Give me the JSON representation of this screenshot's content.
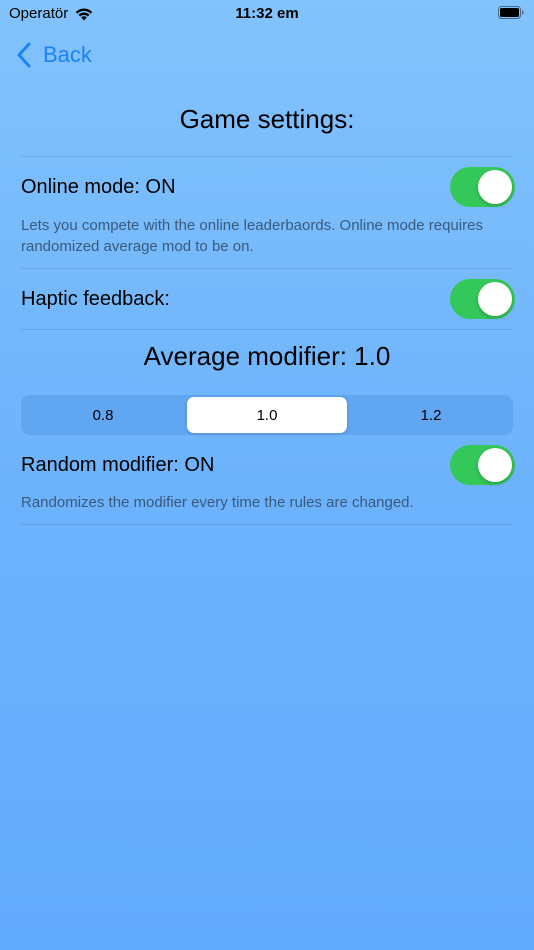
{
  "status_bar": {
    "carrier": "Operatör",
    "time": "11:32 em"
  },
  "nav": {
    "back_label": "Back"
  },
  "page": {
    "title": "Game settings:"
  },
  "settings": {
    "online_mode": {
      "label": "Online mode: ON",
      "description": "Lets you compete with the online leaderbaords. Online mode requires randomized average mod to be on.",
      "enabled": true
    },
    "haptic_feedback": {
      "label": "Haptic feedback:",
      "enabled": true
    },
    "average_modifier": {
      "title": "Average modifier: 1.0",
      "options": [
        "0.8",
        "1.0",
        "1.2"
      ],
      "selected": "1.0"
    },
    "random_modifier": {
      "label": "Random modifier: ON",
      "description": "Randomizes the modifier every time the rules are changed.",
      "enabled": true
    }
  },
  "colors": {
    "accent": "#1a84f7",
    "toggle_on": "#34c759",
    "background_top": "#82c3fc",
    "background_bottom": "#62aafc"
  }
}
